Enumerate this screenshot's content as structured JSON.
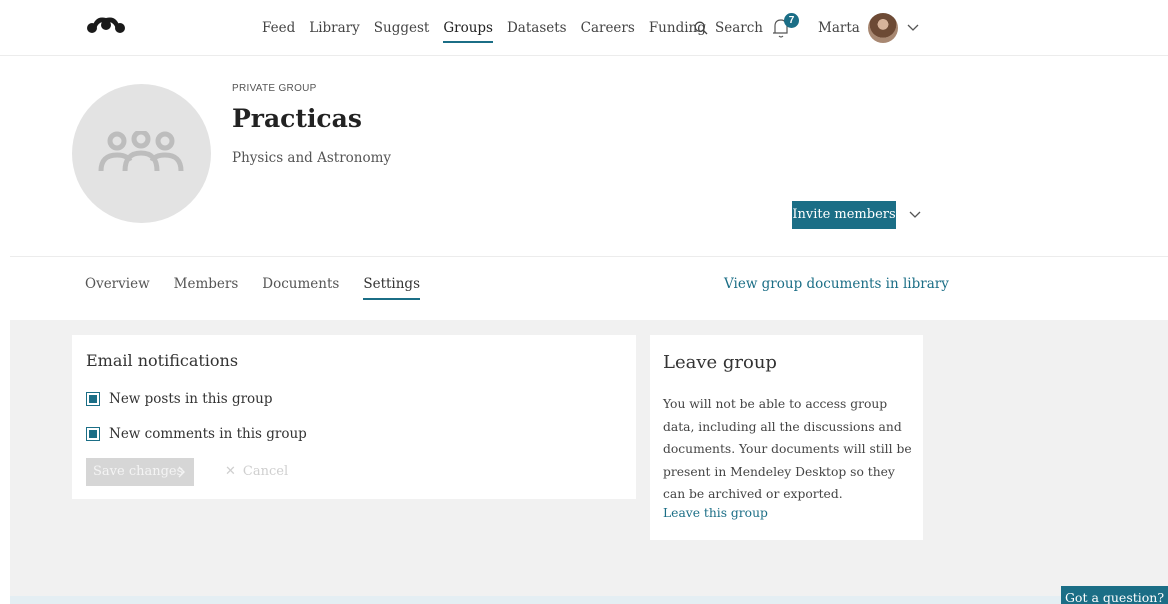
{
  "nav": {
    "items": [
      {
        "label": "Feed",
        "active": false
      },
      {
        "label": "Library",
        "active": false
      },
      {
        "label": "Suggest",
        "active": false
      },
      {
        "label": "Groups",
        "active": true
      },
      {
        "label": "Datasets",
        "active": false
      },
      {
        "label": "Careers",
        "active": false
      },
      {
        "label": "Funding",
        "active": false
      }
    ],
    "search_label": "Search",
    "notification_count": "7",
    "user_name": "Marta",
    "logo_icon": "mendeley-logo-icon",
    "search_icon": "search-icon",
    "bell_icon": "bell-icon",
    "chevron_icon": "chevron-down-icon"
  },
  "group": {
    "kicker": "PRIVATE GROUP",
    "title": "Practicas",
    "subtitle": "Physics and Astronomy",
    "avatar_icon": "group-people-icon",
    "invite_label": "Invite members"
  },
  "tabs": [
    {
      "label": "Overview",
      "active": false
    },
    {
      "label": "Members",
      "active": false
    },
    {
      "label": "Documents",
      "active": false
    },
    {
      "label": "Settings",
      "active": true
    }
  ],
  "library_link": "View group documents in library",
  "email_card": {
    "title": "Email notifications",
    "options": [
      {
        "label": "New posts in this group",
        "checked": true
      },
      {
        "label": "New comments in this group",
        "checked": true
      }
    ],
    "save_label": "Save changes",
    "cancel_label": "Cancel"
  },
  "leave_card": {
    "title": "Leave group",
    "text": "You will not be able to access group data, including all the discussions and documents. Your documents will still be present in Mendeley Desktop so they can be archived or exported.",
    "link": "Leave this group"
  },
  "help_label": "Got a question?",
  "colors": {
    "accent": "#1b6e86",
    "page_background": "#f1f1f1",
    "avatar_background": "#e3e3e3"
  }
}
